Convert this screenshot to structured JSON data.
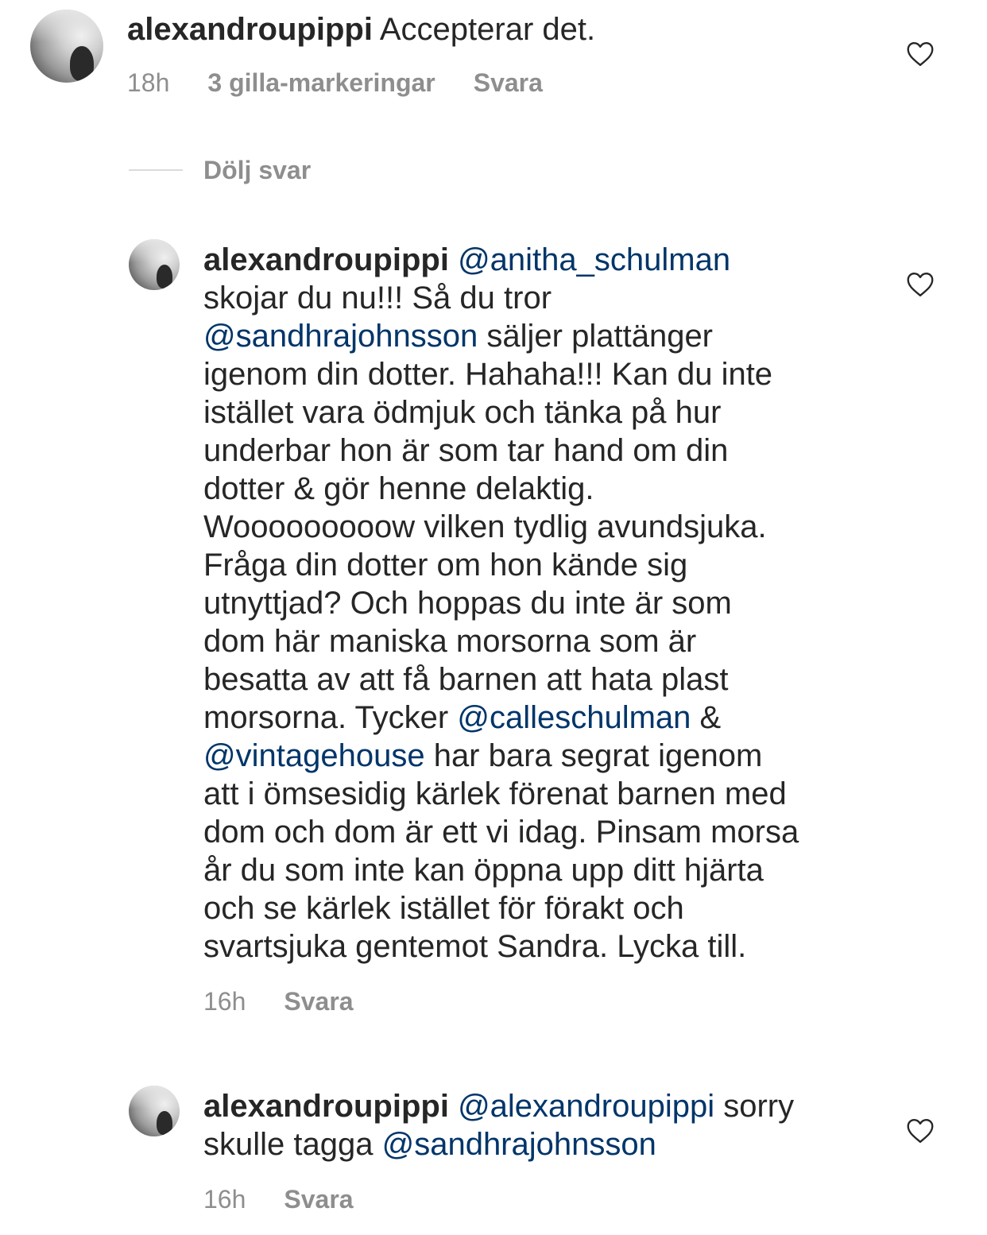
{
  "comments": [
    {
      "username": "alexandroupippi",
      "segments": [
        {
          "type": "text",
          "text": " Accepterar det."
        }
      ],
      "time": "18h",
      "likes": "3 gilla-markeringar",
      "reply": "Svara"
    },
    {
      "username": "alexandroupippi",
      "segments": [
        {
          "type": "text",
          "text": " "
        },
        {
          "type": "mention",
          "text": "@anitha_schulman"
        },
        {
          "type": "text",
          "text": "\nskojar du nu!!! Så du tror\n"
        },
        {
          "type": "mention",
          "text": "@sandhrajohnsson"
        },
        {
          "type": "text",
          "text": " säljer plattänger\nigenom din dotter. Hahaha!!! Kan du inte\nistället vara ödmjuk och tänka på hur\nunderbar hon är som tar hand om din\ndotter & gör henne delaktig.\nWooooooooow vilken tydlig avundsjuka.\nFråga din dotter om hon kände sig\nutnyttjad? Och hoppas du inte är som\ndom här maniska morsorna som är\nbesatta av att få barnen att hata plast\nmorsorna. Tycker "
        },
        {
          "type": "mention",
          "text": "@calleschulman"
        },
        {
          "type": "text",
          "text": " &\n"
        },
        {
          "type": "mention",
          "text": "@vintagehouse"
        },
        {
          "type": "text",
          "text": " har bara segrat igenom\natt i ömsesidig kärlek förenat barnen med\ndom och dom är ett vi idag. Pinsam morsa\når du som inte kan öppna upp ditt hjärta\noch se kärlek istället för förakt och\nsvartsjuka gentemot Sandra. Lycka till."
        }
      ],
      "time": "16h",
      "reply": "Svara"
    },
    {
      "username": "alexandroupippi",
      "segments": [
        {
          "type": "text",
          "text": " "
        },
        {
          "type": "mention",
          "text": "@alexandroupippi"
        },
        {
          "type": "text",
          "text": " sorry\nskulle tagga "
        },
        {
          "type": "mention",
          "text": "@sandhrajohnsson"
        }
      ],
      "time": "16h",
      "reply": "Svara"
    }
  ],
  "hide_replies_label": "Dölj svar",
  "icons": {
    "like": "heart-outline-icon"
  },
  "colors": {
    "text": "#262626",
    "meta": "#8e8e8e",
    "mention": "#003569",
    "divider": "#dbdbdb"
  }
}
